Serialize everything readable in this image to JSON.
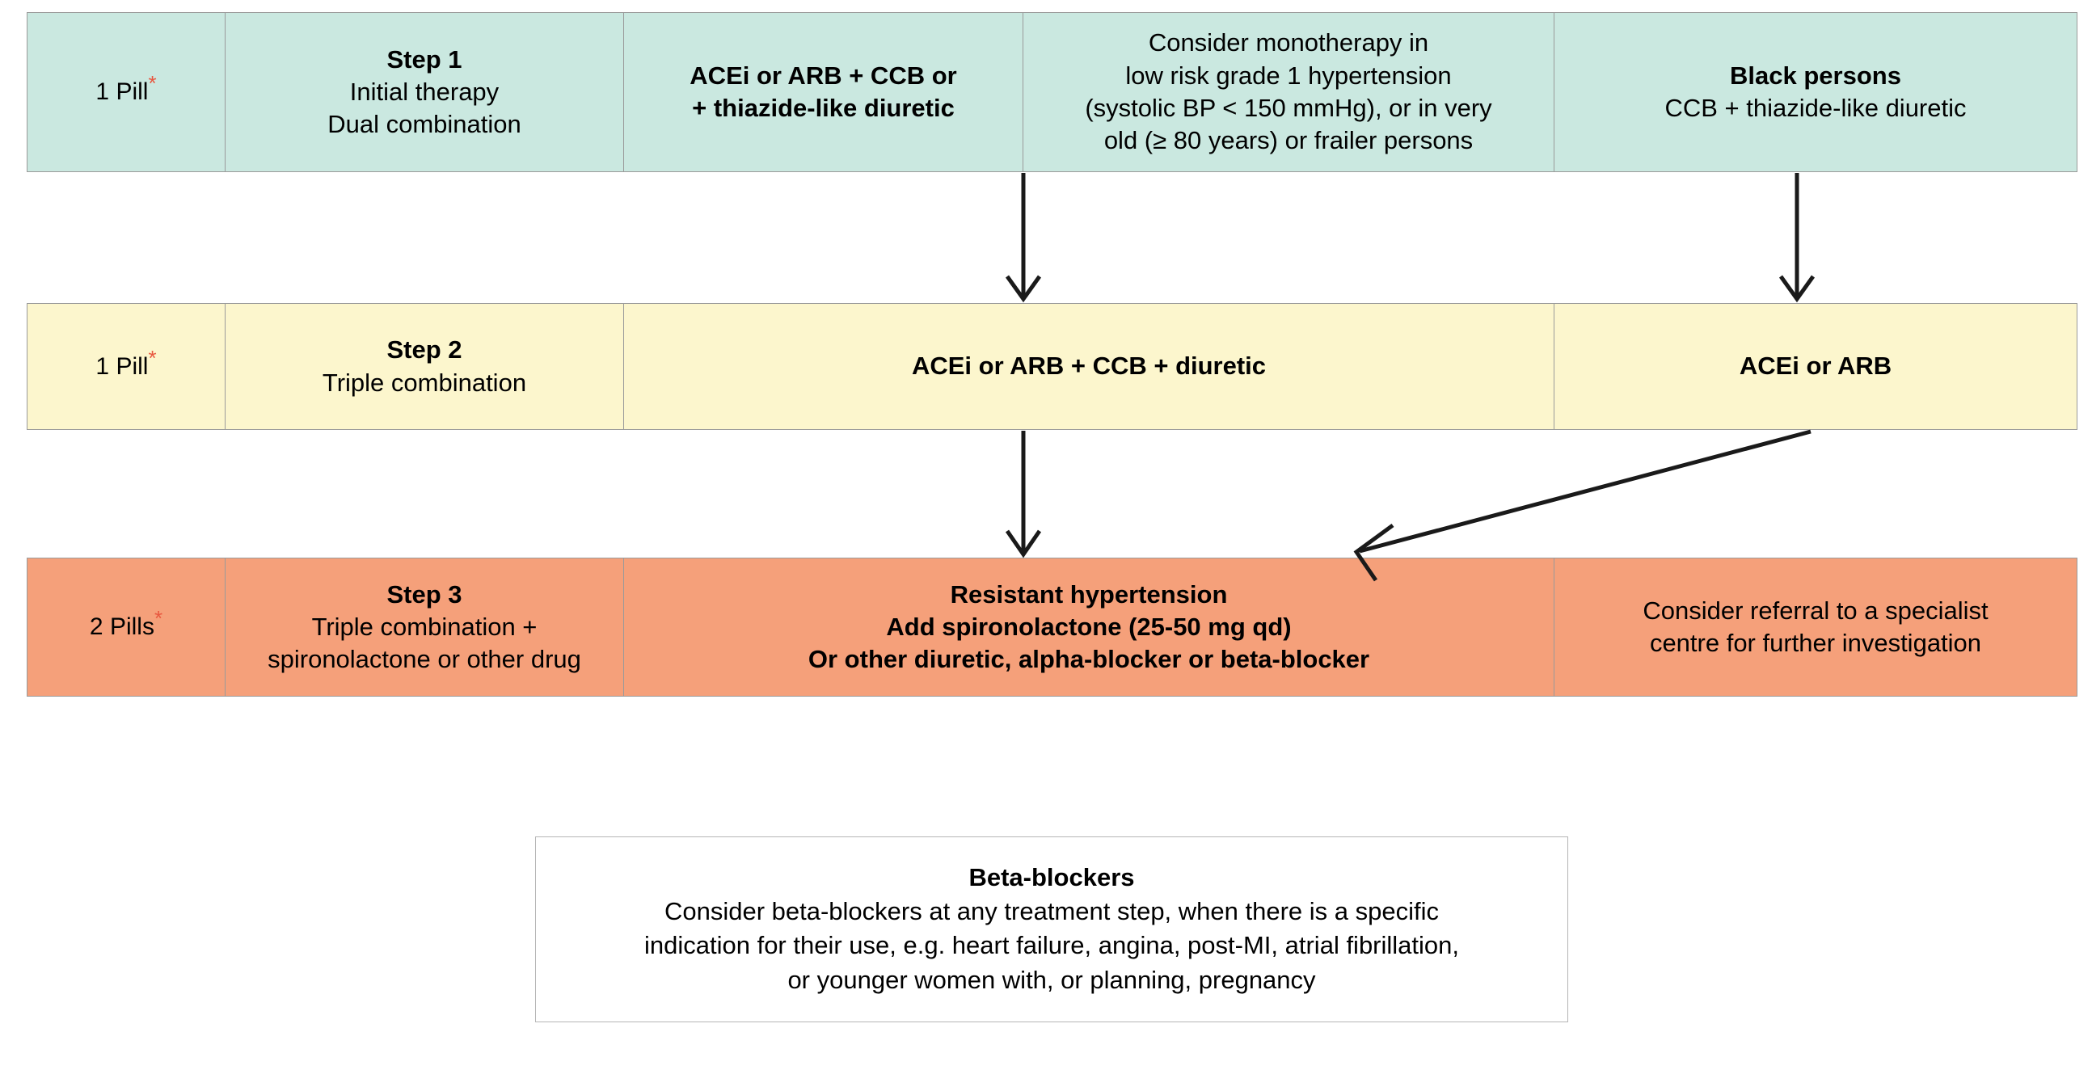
{
  "colors": {
    "step1_band": "#cae8e0",
    "step2_band": "#fcf6cd",
    "step3_band": "#f5a07a",
    "asterisk": "#e8573f",
    "border": "#9a9a9a",
    "arrow": "#1a1a1a",
    "note_box_border": "#b5b5b5"
  },
  "rows": [
    {
      "id": "step-1",
      "pill_count": "1 Pill",
      "pill_asterisk": "*",
      "step_title": "Step 1",
      "step_lines": [
        "Initial therapy",
        "Dual combination"
      ],
      "regimen_lines": [
        "ACEi or ARB + CCB or",
        "+ thiazide-like diuretic"
      ],
      "note_lines": [
        "Consider monotherapy in",
        "low risk grade 1 hypertension",
        "(systolic BP < 150 mmHg), or in very",
        "old (≥ 80 years) or frailer persons"
      ],
      "special_title": "Black persons",
      "special_lines": [
        "CCB + thiazide-like diuretic"
      ]
    },
    {
      "id": "step-2",
      "pill_count": "1 Pill",
      "pill_asterisk": "*",
      "step_title": "Step 2",
      "step_lines": [
        "Triple combination"
      ],
      "regimen_lines": [
        "ACEi or ARB + CCB + diuretic"
      ],
      "special_lines": [
        "ACEi or ARB"
      ]
    },
    {
      "id": "step-3",
      "pill_count": "2 Pills",
      "pill_asterisk": "*",
      "step_title": "Step 3",
      "step_lines": [
        "Triple combination +",
        "spironolactone or other drug"
      ],
      "regimen_lines": [
        "Resistant hypertension",
        "Add spironolactone (25-50 mg qd)",
        "Or other diuretic, alpha-blocker or beta-blocker"
      ],
      "referral_lines": [
        "Consider referral to a specialist",
        "centre for further investigation"
      ]
    }
  ],
  "note_box": {
    "title": "Beta-blockers",
    "lines": [
      "Consider beta-blockers at any treatment step, when there is a specific",
      "indication for their use, e.g. heart failure, angina, post-MI, atrial fibrillation,",
      "or younger women with, or planning, pregnancy"
    ]
  },
  "arrows": [
    {
      "name": "step1-note-to-step2",
      "kind": "vertical-down"
    },
    {
      "name": "step1-black-persons-to-step2",
      "kind": "vertical-down"
    },
    {
      "name": "step2-regimen-to-step3",
      "kind": "vertical-down"
    },
    {
      "name": "step2-acei-arb-to-step3-resistant",
      "kind": "diagonal-down-left"
    }
  ]
}
